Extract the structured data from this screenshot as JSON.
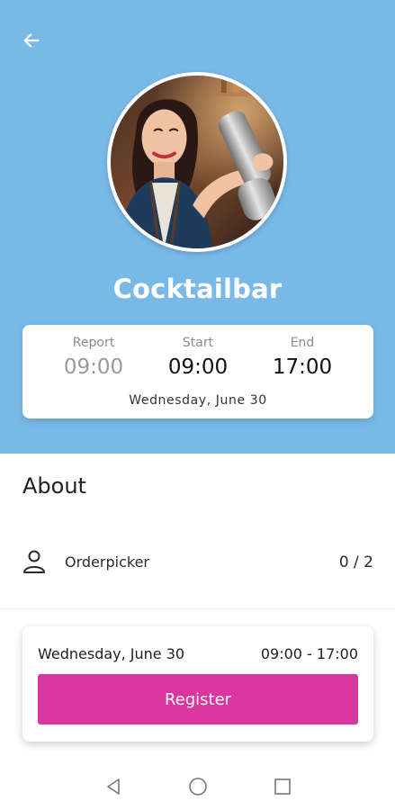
{
  "header": {
    "title": "Cocktailbar",
    "background_color": "#79b9e8",
    "back_icon": "arrow-left-icon",
    "avatar": "bartender-photo"
  },
  "times": {
    "report": {
      "label": "Report",
      "value": "09:00"
    },
    "start": {
      "label": "Start",
      "value": "09:00"
    },
    "end": {
      "label": "End",
      "value": "17:00"
    },
    "date": "Wednesday, June 30"
  },
  "about": {
    "heading": "About",
    "role": {
      "icon": "person-icon",
      "label": "Orderpicker",
      "count": "0 / 2"
    }
  },
  "register": {
    "date": "Wednesday, June 30",
    "time_range": "09:00 - 17:00",
    "button_label": "Register",
    "button_color": "#d936a0"
  },
  "navbar": {
    "icons": [
      "nav-back-icon",
      "nav-home-icon",
      "nav-recent-icon"
    ]
  }
}
